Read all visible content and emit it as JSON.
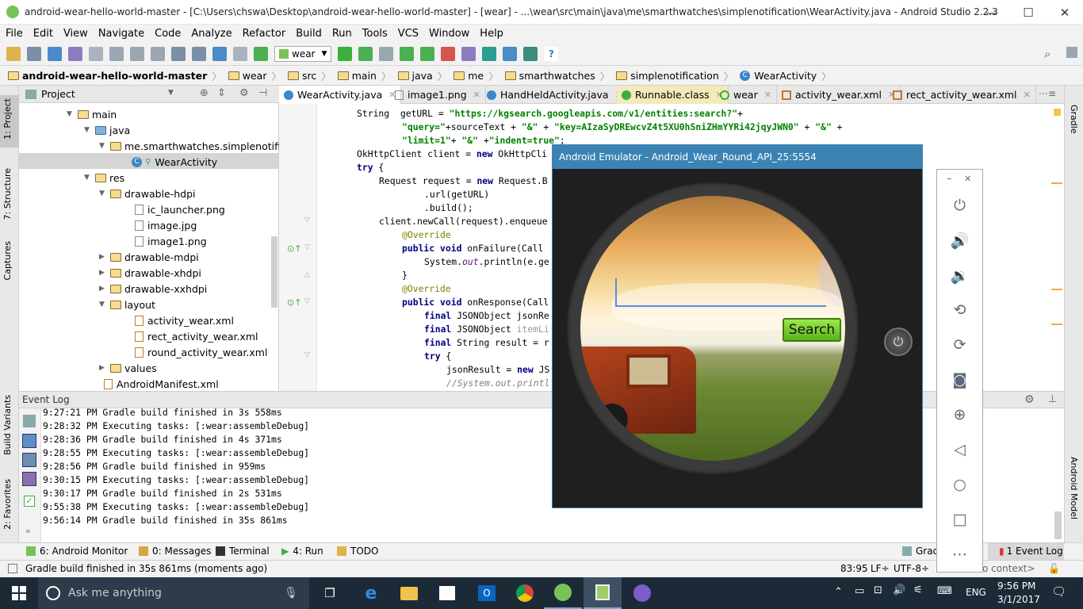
{
  "window": {
    "title": "android-wear-hello-world-master - [C:\\Users\\chswa\\Desktop\\android-wear-hello-world-master] - [wear] - ...\\wear\\src\\main\\java\\me\\smarthwatches\\simplenotification\\WearActivity.java - Android Studio 2.2.3",
    "minimize": "—",
    "maximize": "☐",
    "close": "✕"
  },
  "menu": [
    "File",
    "Edit",
    "View",
    "Navigate",
    "Code",
    "Analyze",
    "Refactor",
    "Build",
    "Run",
    "Tools",
    "VCS",
    "Window",
    "Help"
  ],
  "toolbar": {
    "config": "wear"
  },
  "breadcrumb": [
    "android-wear-hello-world-master",
    "wear",
    "src",
    "main",
    "java",
    "me",
    "smarthwatches",
    "simplenotification",
    "WearActivity"
  ],
  "project": {
    "header": "Project",
    "tree": [
      {
        "label": "main"
      },
      {
        "label": "java"
      },
      {
        "label": "me.smarthwatches.simplenotificati"
      },
      {
        "label": "WearActivity"
      },
      {
        "label": "res"
      },
      {
        "label": "drawable-hdpi"
      },
      {
        "label": "ic_launcher.png"
      },
      {
        "label": "image.jpg"
      },
      {
        "label": "image1.png"
      },
      {
        "label": "drawable-mdpi"
      },
      {
        "label": "drawable-xhdpi"
      },
      {
        "label": "drawable-xxhdpi"
      },
      {
        "label": "layout"
      },
      {
        "label": "activity_wear.xml"
      },
      {
        "label": "rect_activity_wear.xml"
      },
      {
        "label": "round_activity_wear.xml"
      },
      {
        "label": "values"
      },
      {
        "label": "AndroidManifest.xml"
      }
    ]
  },
  "tabs": [
    "WearActivity.java",
    "image1.png",
    "HandHeldActivity.java",
    "Runnable.class",
    "wear",
    "activity_wear.xml",
    "rect_activity_wear.xml"
  ],
  "tabs_more": "⋯≡",
  "code": {
    "l1a": "String  getURL = ",
    "l1b": "\"https://kgsearch.googleapis.com/v1/entities:search?\"",
    "l1c": "+",
    "l2a": "\"query=\"",
    "l2b": "+sourceText + ",
    "l2c": "\"&\"",
    "l2d": " + ",
    "l2e": "\"key=AIzaSyDREwcvZ4t5XU0hSniZHmYYRi42jqyJWN0\"",
    "l2f": " + ",
    "l2g": "\"&\"",
    "l2h": " +",
    "l3a": "\"limit=1\"",
    "l3b": "+ ",
    "l3c": "\"&\"",
    "l3d": " +",
    "l3e": "\"indent=true\"",
    "l3f": ";",
    "l4a": "OkHttpClient client = ",
    "l4b": "new",
    "l4c": " OkHttpCli",
    "l5a": "try",
    "l5b": " {",
    "l6a": "Request request = ",
    "l6b": "new",
    "l6c": " Request.B",
    "l7": ".url(getURL)",
    "l8": ".build();",
    "l9": "client.newCall(request).enqueue",
    "l10": "@Override",
    "l11a": "public void",
    "l11b": " onFailure(Call ",
    "l12a": "System.",
    "l12b": "out",
    "l12c": ".println(e.ge",
    "l13": "}",
    "l14": "@Override",
    "l15a": "public void",
    "l15b": " onResponse(Call",
    "l16a": "final",
    "l16b": " JSONObject jsonRe",
    "l17a": "final",
    "l17b": " JSONObject ",
    "l17c": "itemLi",
    "l18a": "final",
    "l18b": " String result = r",
    "l19a": "try",
    "l19b": " {",
    "l20a": "jsonResult = ",
    "l20b": "new",
    "l20c": " JS",
    "l21": "//System.out.printl"
  },
  "eventlog": {
    "title": "Event Log",
    "lines": [
      "9:27:21 PM Gradle build finished in 3s 558ms",
      "9:28:32 PM Executing tasks: [:wear:assembleDebug]",
      "9:28:36 PM Gradle build finished in 4s 371ms",
      "9:28:55 PM Executing tasks: [:wear:assembleDebug]",
      "9:28:56 PM Gradle build finished in 959ms",
      "9:30:15 PM Executing tasks: [:wear:assembleDebug]",
      "9:30:17 PM Gradle build finished in 2s 531ms",
      "9:55:38 PM Executing tasks: [:wear:assembleDebug]",
      "9:56:14 PM Gradle build finished in 35s 861ms"
    ]
  },
  "bottomtabs": [
    "6: Android Monitor",
    "0: Messages",
    "Terminal",
    "4: Run",
    "TODO",
    "Grad",
    "1  Event Log"
  ],
  "status": {
    "message": "Gradle build finished in 35s 861ms (moments ago)",
    "position": "83:95",
    "lineSep": "LF÷",
    "encoding": "UTF-8÷",
    "context": "o context>"
  },
  "sidestrips": {
    "left": [
      "1: Project",
      "7: Structure",
      "Captures",
      "Build Variants",
      "2: Favorites"
    ],
    "right": [
      "Gradle",
      "Android Model"
    ]
  },
  "emulator": {
    "title": "Android Emulator - Android_Wear_Round_API_25:5554",
    "searchButton": "Search"
  },
  "emuPanel": {
    "minimize": "–",
    "close": "✕"
  },
  "taskbar": {
    "search": "Ask me anything",
    "lang": "ENG",
    "time": "9:56 PM",
    "date": "3/1/2017"
  }
}
